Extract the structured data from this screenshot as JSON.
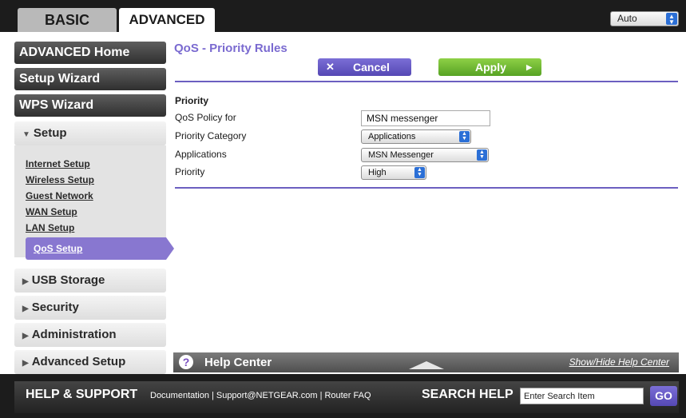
{
  "tabs": {
    "basic": "BASIC",
    "advanced": "ADVANCED"
  },
  "language_select": {
    "value": "Auto"
  },
  "sidebar": {
    "advanced_home": "ADVANCED Home",
    "setup_wizard": "Setup Wizard",
    "wps_wizard": "WPS Wizard",
    "setup_group": "Setup",
    "setup_items": [
      "Internet Setup",
      "Wireless Setup",
      "Guest Network",
      "WAN Setup",
      "LAN Setup"
    ],
    "qos_setup": "QoS Setup",
    "usb_storage": "USB Storage",
    "security": "Security",
    "administration": "Administration",
    "advanced_setup": "Advanced Setup"
  },
  "page": {
    "title": "QoS - Priority Rules",
    "cancel": "Cancel",
    "apply": "Apply",
    "section": "Priority",
    "labels": {
      "policy": "QoS Policy for",
      "category": "Priority Category",
      "applications": "Applications",
      "priority": "Priority"
    },
    "values": {
      "policy": "MSN messenger",
      "category": "Applications",
      "applications": "MSN Messenger",
      "priority": "High"
    }
  },
  "help": {
    "title": "Help Center",
    "toggle": "Show/Hide Help Center"
  },
  "footer": {
    "help_support": "HELP & SUPPORT",
    "links": [
      "Documentation",
      "Support@NETGEAR.com",
      "Router FAQ"
    ],
    "search_help": "SEARCH HELP",
    "search_placeholder": "Enter Search Item",
    "go": "GO"
  }
}
